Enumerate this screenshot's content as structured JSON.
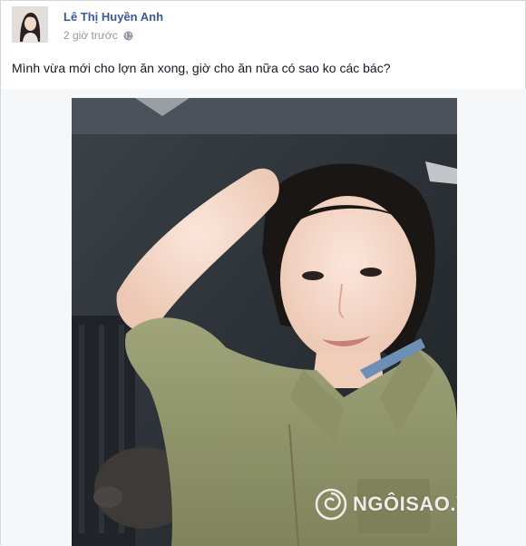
{
  "post": {
    "author_name": "Lê Thị Huyền Anh",
    "timestamp": "2 giờ trước",
    "privacy_icon": "globe-icon",
    "status_text": "Mình vừa mới cho lợn ăn xong, giờ cho ăn nữa có sao ko các bác?"
  },
  "watermark": {
    "text": "NGÔISAO.VN",
    "icon": "spiral-logo-icon"
  },
  "colors": {
    "link_blue": "#3b5998",
    "meta_gray": "#9197a3",
    "text_dark": "#141823"
  }
}
